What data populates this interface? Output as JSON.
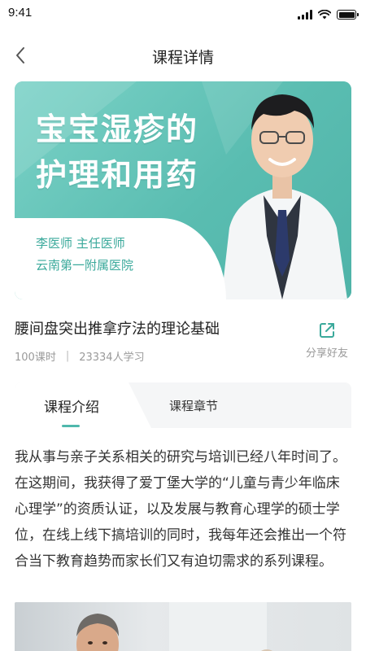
{
  "status_bar": {
    "time": "9:41"
  },
  "nav": {
    "title": "课程详情",
    "back_icon": "chevron-left-icon"
  },
  "banner": {
    "title_line1": "宝宝湿疹的",
    "title_line2": "护理和用药",
    "doctor_line1": "李医师  主任医师",
    "doctor_line2": "云南第一附属医院",
    "accent_color": "#5abdb1"
  },
  "course": {
    "title": "腰间盘突出推拿疗法的理论基础",
    "lessons": "100课时",
    "separator": "|",
    "learners": "23334人学习",
    "share_label": "分享好友"
  },
  "tabs": [
    {
      "label": "课程介绍",
      "active": true
    },
    {
      "label": "课程章节",
      "active": false
    }
  ],
  "intro": {
    "text": "我从事与亲子关系相关的研究与培训已经八年时间了。在这期间，我获得了爱丁堡大学的“儿童与青少年临床心理学”的资质认证，以及发展与教育心理学的硕士学位，在线上线下搞培训的同时，我每年还会推出一个符合当下教育趋势而家长们又有迫切需求的系列课程。"
  }
}
